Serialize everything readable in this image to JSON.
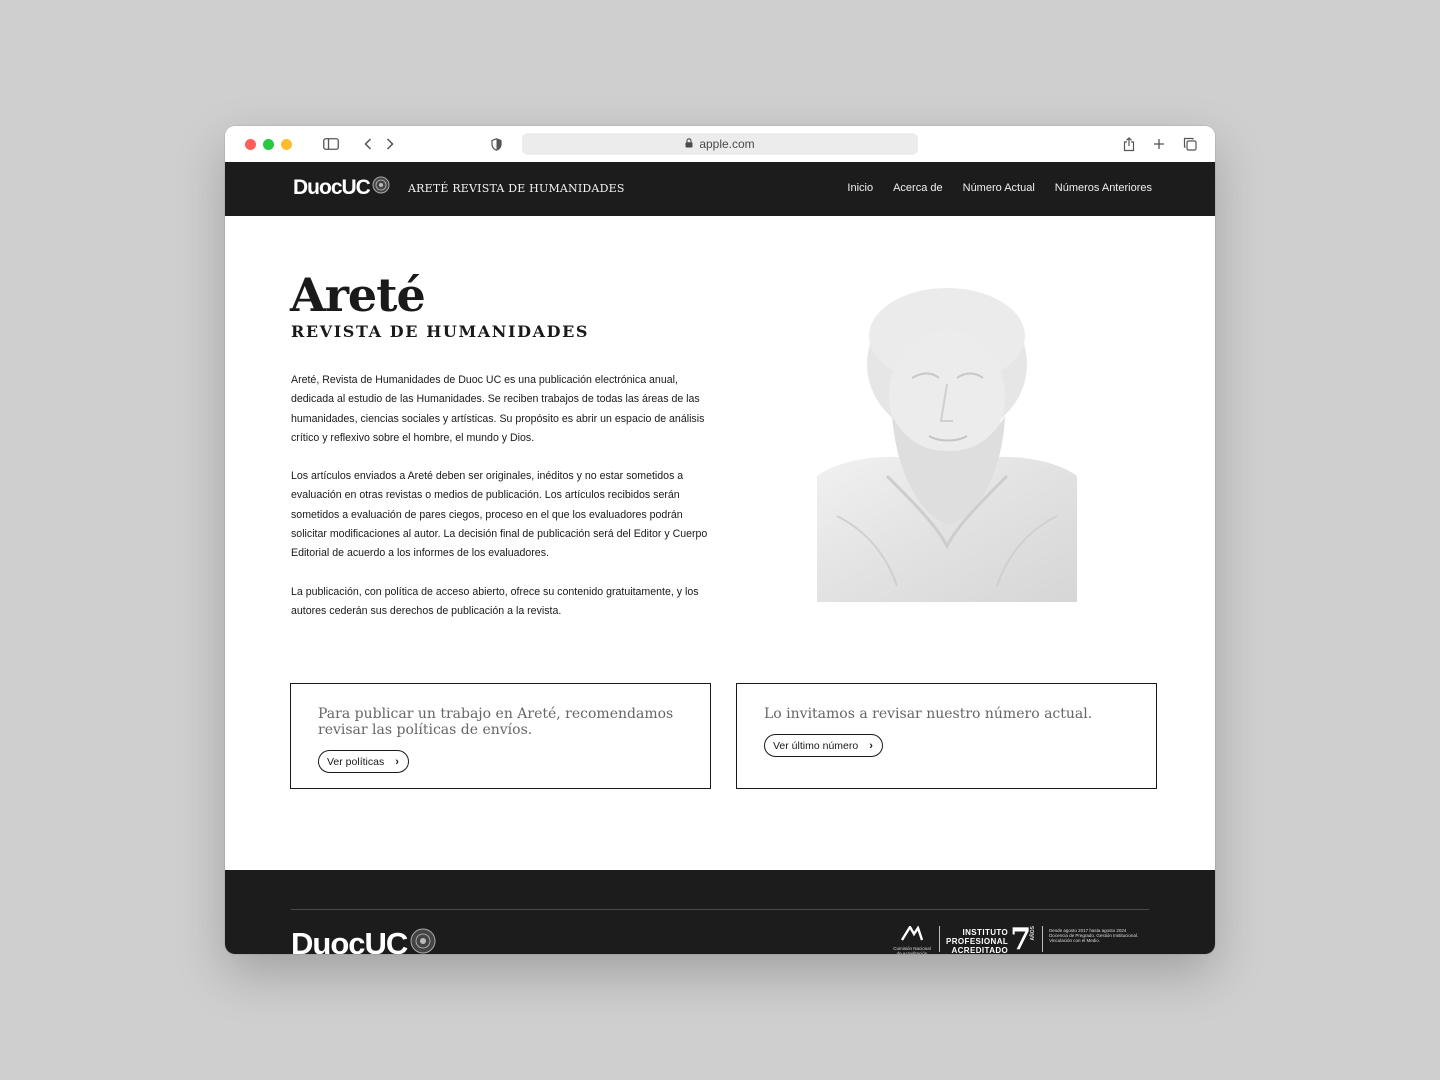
{
  "browser": {
    "url": "apple.com"
  },
  "header": {
    "logo": "DuocUC",
    "site_title": "ARETÉ REVISTA DE HUMANIDADES",
    "nav": [
      {
        "label": "Inicio"
      },
      {
        "label": "Acerca de"
      },
      {
        "label": "Número Actual"
      },
      {
        "label": "Números Anteriores"
      }
    ]
  },
  "hero": {
    "title": "Areté",
    "subtitle": "REVISTA DE HUMANIDADES",
    "paragraphs": [
      "Areté, Revista de Humanidades de Duoc UC es una publicación electrónica anual, dedicada al estudio de las Humanidades. Se reciben trabajos de todas las áreas de las humanidades, ciencias sociales y artísticas. Su propósito es abrir un espacio de análisis crítico y reflexivo sobre el hombre, el mundo y Dios.",
      "Los artículos enviados a Areté deben ser originales, inéditos y no estar sometidos a evaluación en otras revistas o medios de publicación. Los artículos recibidos serán sometidos a evaluación de pares ciegos, proceso en el que los evaluadores podrán solicitar modificaciones al autor. La decisión final de publicación será del Editor y Cuerpo Editorial de acuerdo a los informes de los evaluadores.",
      "La publicación, con política de acceso abierto, ofrece su contenido gratuitamente, y los autores cederán sus derechos de publicación a la revista."
    ]
  },
  "cards": [
    {
      "text": "Para publicar un trabajo en Areté, recomendamos revisar las políticas de envíos.",
      "button": "Ver políticas"
    },
    {
      "text": "Lo invitamos a revisar nuestro número actual.",
      "button": "Ver último número"
    }
  ],
  "footer": {
    "logo": "DuocUC",
    "accreditation": {
      "agency": "Comisión Nacional de Acreditación",
      "title_line1": "INSTITUTO",
      "title_line2": "PROFESIONAL",
      "title_line3": "ACREDITADO",
      "years": "7",
      "years_label": "AÑOS",
      "detail_line1": "Desde agosto 2017 hasta agosto 2024",
      "detail_line2": "Docencia de Pregrado. Gestión Institucional.",
      "detail_line3": "Vinculación con el Medio."
    }
  },
  "colors": {
    "header_bg": "#1c1c1c",
    "footer_bg": "#1c1c1c",
    "page_bg": "#cfcfcf",
    "text": "#1a1a1a",
    "card_text": "#666666"
  }
}
